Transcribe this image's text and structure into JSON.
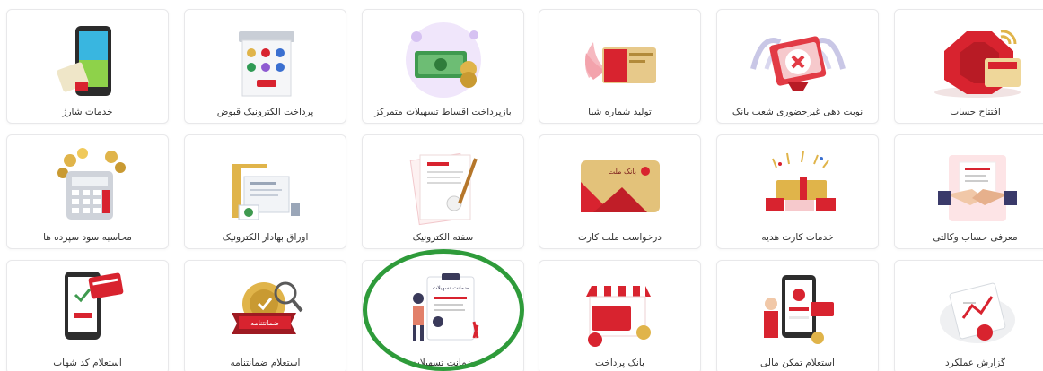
{
  "colors": {
    "brand": "#e02b37",
    "gold": "#e0b44a",
    "green_ring": "#2e9b3a"
  },
  "tiles": [
    {
      "label": "افتتاح حساب",
      "icon": "open-account-icon"
    },
    {
      "label": "نوبت دهی غیرحضوری شعب بانک",
      "icon": "branch-appointment-icon"
    },
    {
      "label": "تولید شماره شبا",
      "icon": "sheba-number-icon"
    },
    {
      "label": "بازپرداخت اقساط تسهیلات متمرکز",
      "icon": "loan-repayment-icon"
    },
    {
      "label": "پرداخت الکترونیک قبوض",
      "icon": "bill-payment-icon"
    },
    {
      "label": "خدمات شارژ",
      "icon": "mobile-charge-icon"
    },
    {
      "label": "معرفی حساب وکالتی",
      "icon": "proxy-account-icon"
    },
    {
      "label": "خدمات کارت هدیه",
      "icon": "gift-card-icon"
    },
    {
      "label": "درخواست ملت کارت",
      "icon": "mellat-card-icon"
    },
    {
      "label": "سفته الکترونیک",
      "icon": "electronic-promissory-note-icon"
    },
    {
      "label": "اوراق بهادار الکترونیک",
      "icon": "electronic-securities-icon"
    },
    {
      "label": "محاسبه سود سپرده ها",
      "icon": "deposit-interest-calculator-icon"
    },
    {
      "label": "گزارش عملکرد",
      "icon": "performance-report-icon"
    },
    {
      "label": "استعلام تمکن مالی",
      "icon": "financial-capacity-inquiry-icon"
    },
    {
      "label": "بانک پرداخت",
      "icon": "bank-pardakht-icon"
    },
    {
      "label": "ضمانت تسهیلات",
      "icon": "loan-guarantee-icon"
    },
    {
      "label": "استعلام ضمانتنامه",
      "icon": "guarantee-inquiry-icon"
    },
    {
      "label": "استعلام کد شهاب",
      "icon": "shahab-code-inquiry-icon"
    }
  ],
  "art_text": {
    "mellat_card_brand": "بانک ملت",
    "guarantee_badge": "ضمانتنامه",
    "loan_guarantee_board": "ضمانت تسهیلات"
  }
}
